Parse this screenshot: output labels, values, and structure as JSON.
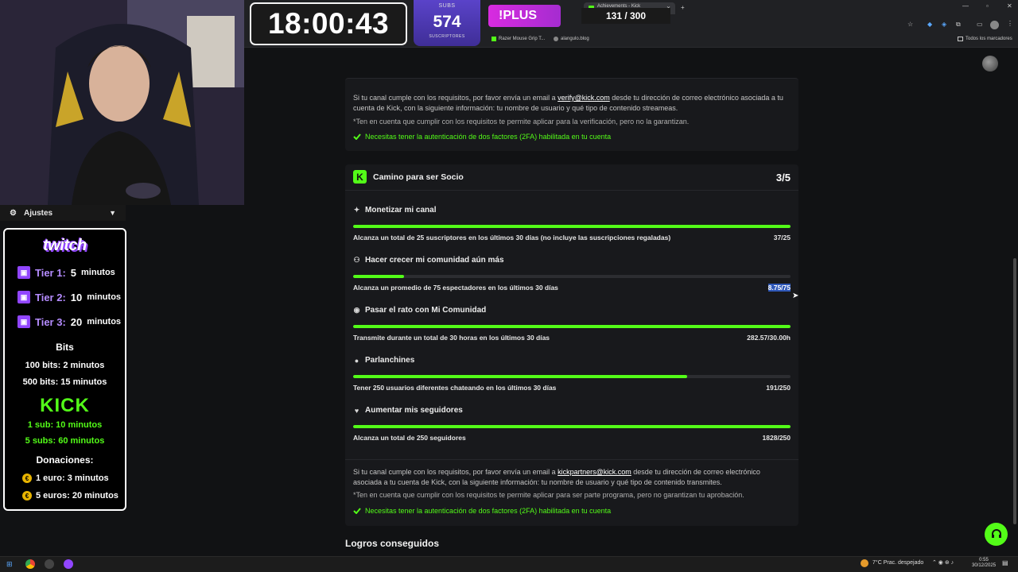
{
  "overlay": {
    "timer": "18:00:43",
    "subs_label": "SUBS",
    "subs_value": "574",
    "subs_sublabel": "SUSCRIPTORES",
    "plus_label": "!PLUS",
    "goal": "131 / 300"
  },
  "browser": {
    "tabs": [
      {
        "label": "Achievements - Kick Dashboard",
        "active": true
      }
    ],
    "bookmarks": [
      "Razer Mouse Grip T...",
      "alangulo.blog"
    ],
    "all_bookmarks": "Todos los marcadores"
  },
  "verification_card": {
    "pre_link": "Si tu canal cumple con los requisitos, por favor envía un email a ",
    "email": "verify@kick.com",
    "post_link": " desde tu dirección de correo electrónico asociada a tu cuenta de Kick, con la siguiente información: tu nombre de usuario y qué tipo de contenido streameas.",
    "note": "*Ten en cuenta que cumplir con los requisitos te permite aplicar para la verificación, pero no la garantizan.",
    "twofa": "Necesitas tener la autenticación de dos factores (2FA) habilitada en tu cuenta"
  },
  "partner_card": {
    "title": "Camino para ser Socio",
    "count": "3/5",
    "requirements": [
      {
        "icon": "sparkle-icon",
        "title": "Monetizar mi canal",
        "desc": "Alcanza un total de 25 suscriptores en los últimos 30 días (no incluye las suscripciones regaladas)",
        "value": "37/25",
        "progress": 1.0
      },
      {
        "icon": "growth-icon",
        "title": "Hacer crecer mi comunidad aún más",
        "desc": "Alcanza un promedio de 75 espectadores en los últimos 30 días",
        "value": "8.75/75",
        "progress": 0.117
      },
      {
        "icon": "broadcast-icon",
        "title": "Pasar el rato con Mi Comunidad",
        "desc": "Transmite durante un total de 30 horas en los últimos 30 días",
        "value": "282.57/30.00h",
        "progress": 1.0
      },
      {
        "icon": "chat-bubble-icon",
        "title": "Parlanchines",
        "desc": "Tener 250 usuarios diferentes chateando en los últimos 30 días",
        "value": "191/250",
        "progress": 0.764
      },
      {
        "icon": "heart-icon",
        "title": "Aumentar mis seguidores",
        "desc": "Alcanza un total de 250 seguidores",
        "value": "1828/250",
        "progress": 1.0
      }
    ],
    "pre_link": "Si tu canal cumple con los requisitos, por favor envía un email a ",
    "email": "kickpartners@kick.com",
    "post_link": " desde tu dirección de correo electrónico asociada a tu cuenta de Kick, con la siguiente información: tu nombre de usuario y qué tipo de contenido transmites.",
    "note": "*Ten en cuenta que cumplir con los requisitos te permite aplicar para ser parte programa, pero no garantizan tu aprobación.",
    "twofa": "Necesitas tener la autenticación de dos factores (2FA) habilitada en tu cuenta"
  },
  "achievements_heading": "Logros conseguidos",
  "sidebar": {
    "ajustes": "Ajustes",
    "twitch": "twitch",
    "tiers": [
      {
        "name": "Tier 1:",
        "value": "5",
        "unit": "minutos"
      },
      {
        "name": "Tier 2:",
        "value": "10",
        "unit": "minutos"
      },
      {
        "name": "Tier 3:",
        "value": "20",
        "unit": "minutos"
      }
    ],
    "bits_title": "Bits",
    "bits": [
      "100 bits: 2 minutos",
      "500 bits: 15 minutos"
    ],
    "kick": "KICK",
    "kick_subs": [
      "1 sub: 10 minutos",
      "5 subs: 60 minutos"
    ],
    "donaciones_title": "Donaciones:",
    "donaciones": [
      "1 euro: 3 minutos",
      "5 euros: 20 minutos"
    ]
  },
  "taskbar": {
    "weather": "7°C  Prac. despejado",
    "time": "0:55",
    "date": "30/12/2025"
  },
  "colors": {
    "kick_green": "#53fc18",
    "twitch_purple": "#9146ff",
    "selection_blue": "#2f58b8"
  }
}
